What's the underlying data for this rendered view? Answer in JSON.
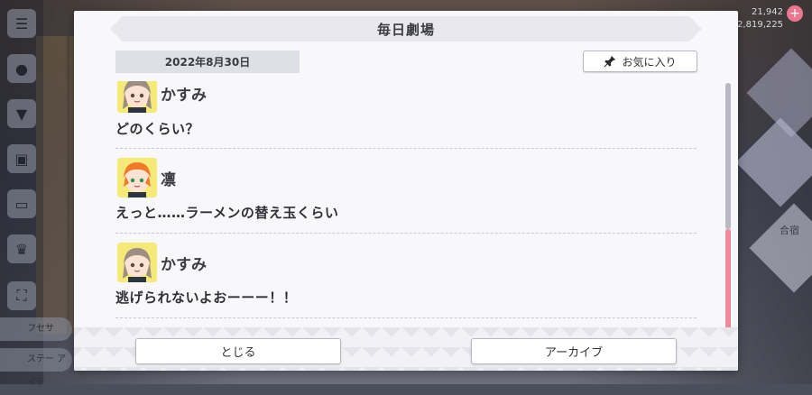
{
  "modal": {
    "title": "毎日劇場",
    "date": "2022年8月30日",
    "favorite_label": "お気に入り",
    "close_label": "とじる",
    "archive_label": "アーカイブ"
  },
  "dialog": [
    {
      "speaker": "かすみ",
      "text": "どのくらい？",
      "avatar_color": "#f5e97a",
      "hair_color": "#9c8e80"
    },
    {
      "speaker": "凛",
      "text": "えっと……ラーメンの替え玉くらい",
      "avatar_color": "#f5e97a",
      "hair_color": "#f07a2a"
    },
    {
      "speaker": "かすみ",
      "text": "逃げられないよおーーー！！",
      "avatar_color": "#f5e97a",
      "hair_color": "#9c8e80"
    }
  ],
  "background": {
    "stat_top": "21,942",
    "stat_bottom": "2,819,225",
    "rail_tab_1": "フセサ",
    "rail_tab_2": "ステー アイテ",
    "right_label": "合宿"
  },
  "colors": {
    "accent_scroll": "#ef8a9a",
    "avatar_bg": "#f5e97a"
  }
}
